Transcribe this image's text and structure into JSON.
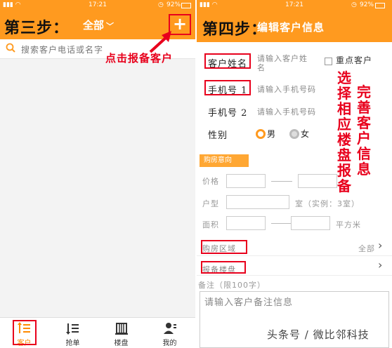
{
  "left": {
    "status_time": "17:21",
    "status_battery": "92%",
    "step": "第三步：",
    "filter": "全部",
    "plus": "+",
    "search_placeholder": "搜索客户电话或名字",
    "annotation": "点击报备客户",
    "tabs": [
      {
        "label": "客户",
        "icon": "customer-list-icon"
      },
      {
        "label": "抢单",
        "icon": "grab-order-icon"
      },
      {
        "label": "楼盘",
        "icon": "building-icon"
      },
      {
        "label": "我的",
        "icon": "profile-icon"
      }
    ]
  },
  "right": {
    "status_time": "17:21",
    "status_battery": "92%",
    "step": "第四步：",
    "title": "编辑客户信息",
    "name_label": "客户姓名",
    "name_placeholder": "请输入客户姓名",
    "vip_label": "重点客户",
    "phone1_label": "手机号 1",
    "phone1_placeholder": "请输入手机号码",
    "phone2_label": "手机号 2",
    "phone2_placeholder": "请输入手机号码",
    "gender_label": "性别",
    "gender_male": "男",
    "gender_female": "女",
    "intent_section": "购房意向",
    "price_label": "价格",
    "layout_label": "户型",
    "layout_unit": "室（实例：3室）",
    "area_label": "面积",
    "area_unit": "平方米",
    "region_label": "购房区域",
    "region_value": "全部",
    "project_label": "报备楼盘",
    "notes_label": "备注（限100字）",
    "notes_placeholder": "请输入客户备注信息",
    "annot_col1": "完善客户信息",
    "annot_col2": "选择相应楼盘报备"
  },
  "watermark": "头条号 / 微比邻科技",
  "colors": {
    "accent": "#ff9a1f",
    "annotation": "#e8001c"
  }
}
